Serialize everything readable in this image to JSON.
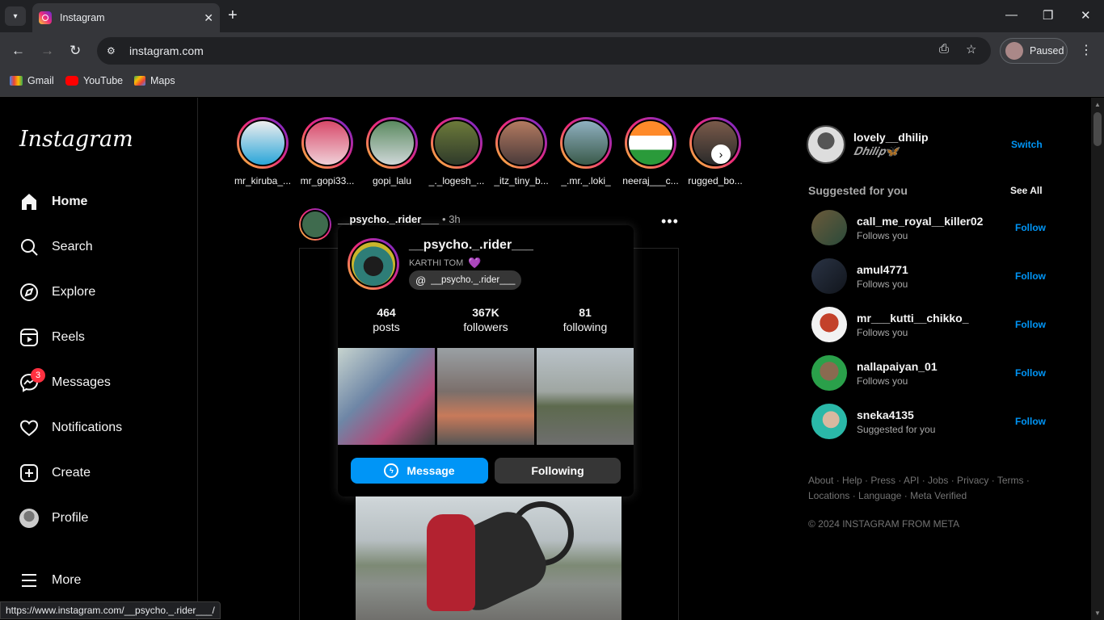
{
  "browser": {
    "tab_title": "Instagram",
    "url": "instagram.com",
    "profile_status": "Paused",
    "bookmarks": [
      "Gmail",
      "YouTube",
      "Maps"
    ],
    "status_url": "https://www.instagram.com/__psycho._.rider___/"
  },
  "sidebar": {
    "logo": "Instagram",
    "items": [
      {
        "label": "Home"
      },
      {
        "label": "Search"
      },
      {
        "label": "Explore"
      },
      {
        "label": "Reels"
      },
      {
        "label": "Messages",
        "badge": "3"
      },
      {
        "label": "Notifications"
      },
      {
        "label": "Create"
      },
      {
        "label": "Profile"
      },
      {
        "label": "More"
      }
    ]
  },
  "stories": [
    {
      "name": "mr_kiruba_..."
    },
    {
      "name": "mr_gopi33..."
    },
    {
      "name": "gopi_lalu"
    },
    {
      "name": "_._logesh_..."
    },
    {
      "name": "_itz_tiny_b..."
    },
    {
      "name": "_.mr._.loki_"
    },
    {
      "name": "neeraj___c..."
    },
    {
      "name": "rugged_bo..."
    }
  ],
  "post": {
    "username": "__psycho._.rider___",
    "time": "• 3h"
  },
  "hover_card": {
    "username": "__psycho._.rider___",
    "full_name": "KARTHI TOM",
    "heart": "💜",
    "threads_handle": "__psycho._.rider___",
    "stats": [
      {
        "num": "464",
        "label": "posts"
      },
      {
        "num": "367K",
        "label": "followers"
      },
      {
        "num": "81",
        "label": "following"
      }
    ],
    "message_btn": "Message",
    "following_btn": "Following"
  },
  "right": {
    "me_username": "lovely__dhilip",
    "me_name": "𝑫𝒉𝒊𝒍𝒊𝒑🦋",
    "switch": "Switch",
    "suggested_heading": "Suggested for you",
    "see_all": "See All",
    "suggestions": [
      {
        "username": "call_me_royal__killer02",
        "sub": "Follows you",
        "action": "Follow"
      },
      {
        "username": "amul4771",
        "sub": "Follows you",
        "action": "Follow"
      },
      {
        "username": "mr___kutti__chikko_",
        "sub": "Follows you",
        "action": "Follow"
      },
      {
        "username": "nallapaiyan_01",
        "sub": "Follows you",
        "action": "Follow"
      },
      {
        "username": "sneka4135",
        "sub": "Suggested for you",
        "action": "Follow"
      }
    ],
    "footer_line1": "About · Help · Press · API · Jobs · Privacy · Terms ·",
    "footer_line2": "Locations · Language · Meta Verified",
    "copyright": "© 2024 INSTAGRAM FROM META"
  }
}
